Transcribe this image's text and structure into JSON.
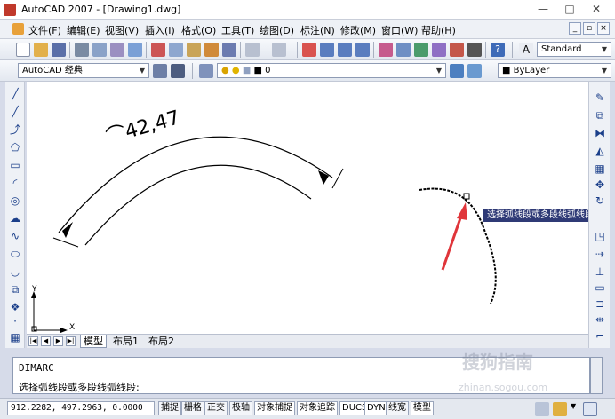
{
  "window": {
    "title": "AutoCAD 2007 - [Drawing1.dwg]",
    "controls": [
      "—",
      "□",
      "✕"
    ]
  },
  "menu": {
    "items": [
      "文件(F)",
      "编辑(E)",
      "视图(V)",
      "插入(I)",
      "格式(O)",
      "工具(T)",
      "绘图(D)",
      "标注(N)",
      "修改(M)",
      "窗口(W)",
      "帮助(H)"
    ],
    "mdi_controls": [
      "_",
      "▫",
      "×"
    ]
  },
  "toolbar": {
    "text_style": "Standard"
  },
  "workspace": {
    "name": "AutoCAD 经典",
    "layer": "0",
    "color": "ByLayer"
  },
  "drawing": {
    "dimension_text": "⌒42,47",
    "ucs_x": "X",
    "ucs_y": "Y",
    "tooltip": "选择弧线段或多段线弧线段:"
  },
  "tabs": {
    "items": [
      "模型",
      "布局1",
      "布局2"
    ]
  },
  "command": {
    "line1": "DIMARC",
    "line2": "选择弧线段或多段线弧线段:"
  },
  "status": {
    "coords": "912.2282, 497.2963, 0.0000",
    "buttons": [
      "捕捉",
      "栅格",
      "正交",
      "极轴",
      "对象捕捉",
      "对象追踪",
      "DUCS",
      "DYN",
      "线宽",
      "模型"
    ]
  },
  "watermark": {
    "text": "搜狗指南",
    "sub": "zhinan.sogou.com"
  },
  "colors": {
    "arrow": "#e0353a",
    "tooltip_bg": "#2f3a76",
    "canvas": "#ffffff"
  }
}
